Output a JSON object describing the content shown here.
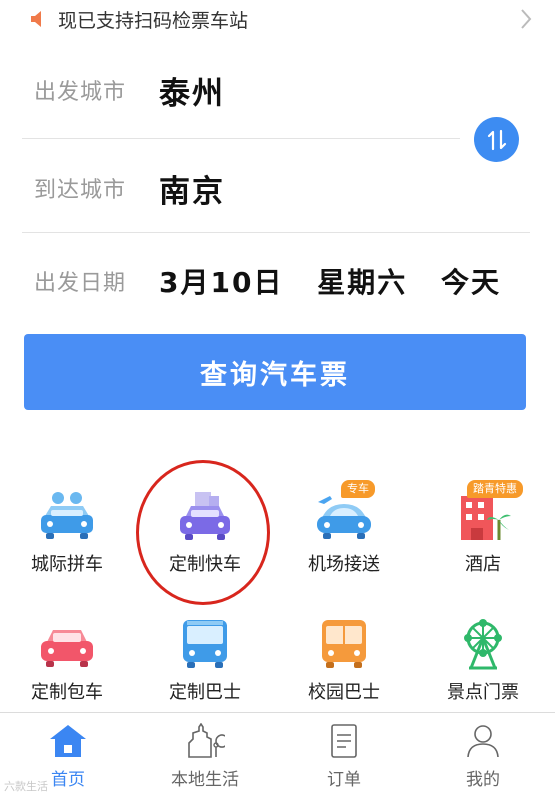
{
  "notice": {
    "text": "现已支持扫码检票车站"
  },
  "form": {
    "from_label": "出发城市",
    "from_value": "泰州",
    "to_label": "到达城市",
    "to_value": "南京",
    "date_label": "出发日期",
    "date_value": "3月10日",
    "weekday": "星期六",
    "relative_day": "今天"
  },
  "search_button": "查询汽车票",
  "services": [
    {
      "label": "城际拼车",
      "icon": "carpool-icon"
    },
    {
      "label": "定制快车",
      "icon": "custom-express-icon"
    },
    {
      "label": "机场接送",
      "icon": "airport-transfer-icon",
      "badge": "专车"
    },
    {
      "label": "酒店",
      "icon": "hotel-icon",
      "badge": "踏青特惠"
    },
    {
      "label": "定制包车",
      "icon": "charter-car-icon"
    },
    {
      "label": "定制巴士",
      "icon": "custom-bus-icon"
    },
    {
      "label": "校园巴士",
      "icon": "campus-bus-icon"
    },
    {
      "label": "景点门票",
      "icon": "ferris-wheel-icon"
    }
  ],
  "tabs": [
    {
      "label": "首页",
      "icon": "home-icon",
      "active": true
    },
    {
      "label": "本地生活",
      "icon": "local-life-icon"
    },
    {
      "label": "订单",
      "icon": "orders-icon"
    },
    {
      "label": "我的",
      "icon": "profile-icon"
    }
  ],
  "watermark": "六款生活",
  "colors": {
    "accent": "#4a8ef5",
    "active_tab": "#3b86f2",
    "annotation": "#d8261d",
    "badge": "#f79a2a"
  }
}
